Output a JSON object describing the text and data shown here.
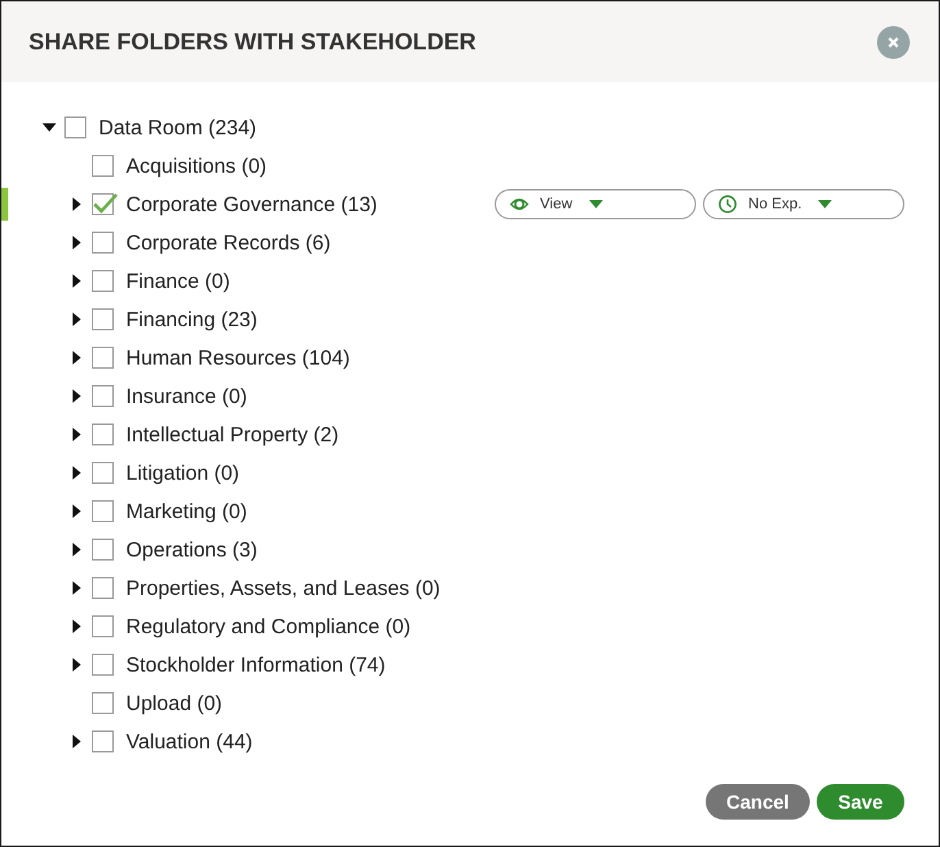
{
  "dialog": {
    "title": "SHARE FOLDERS WITH STAKEHOLDER"
  },
  "tree": [
    {
      "label": "Data Room (234)",
      "expanded": true,
      "checked": false,
      "children": [
        {
          "label": "Acquisitions (0)",
          "has_children": false,
          "checked": false,
          "selected": false
        },
        {
          "label": "Corporate Governance (13)",
          "has_children": true,
          "checked": true,
          "selected": true,
          "access": "View",
          "expiry": "No Exp."
        },
        {
          "label": "Corporate Records (6)",
          "has_children": true,
          "checked": false,
          "selected": false
        },
        {
          "label": "Finance (0)",
          "has_children": true,
          "checked": false,
          "selected": false
        },
        {
          "label": "Financing (23)",
          "has_children": true,
          "checked": false,
          "selected": false
        },
        {
          "label": "Human Resources (104)",
          "has_children": true,
          "checked": false,
          "selected": false
        },
        {
          "label": "Insurance (0)",
          "has_children": true,
          "checked": false,
          "selected": false
        },
        {
          "label": "Intellectual Property (2)",
          "has_children": true,
          "checked": false,
          "selected": false
        },
        {
          "label": "Litigation (0)",
          "has_children": true,
          "checked": false,
          "selected": false
        },
        {
          "label": "Marketing (0)",
          "has_children": true,
          "checked": false,
          "selected": false
        },
        {
          "label": "Operations (3)",
          "has_children": true,
          "checked": false,
          "selected": false
        },
        {
          "label": "Properties, Assets, and Leases (0)",
          "has_children": true,
          "checked": false,
          "selected": false
        },
        {
          "label": "Regulatory and Compliance (0)",
          "has_children": true,
          "checked": false,
          "selected": false
        },
        {
          "label": "Stockholder Information (74)",
          "has_children": true,
          "checked": false,
          "selected": false
        },
        {
          "label": "Upload (0)",
          "has_children": false,
          "checked": false,
          "selected": false
        },
        {
          "label": "Valuation (44)",
          "has_children": true,
          "checked": false,
          "selected": false
        }
      ]
    }
  ],
  "buttons": [
    {
      "label": "Cancel",
      "kind": "secondary"
    },
    {
      "label": "Save",
      "kind": "primary"
    }
  ]
}
